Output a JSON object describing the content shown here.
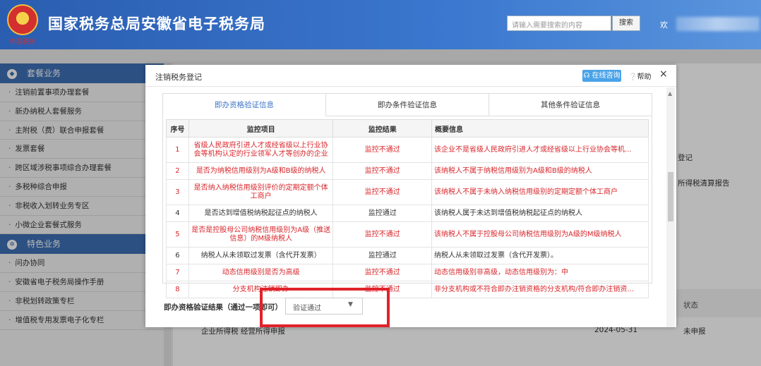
{
  "header": {
    "emblem_caption": "中国税务",
    "title": "国家税务总局安徽省电子税务局",
    "search_placeholder": "请输入需要搜索的内容",
    "search_button": "搜索",
    "welcome": "欢"
  },
  "sidebar": {
    "section1": "套餐业务",
    "section1_items": [
      "注销前置事项办理套餐",
      "新办纳税人套餐服务",
      "主附税（费）联合申报套餐",
      "发票套餐",
      "跨区域涉税事项综合办理套餐",
      "多税种综合申报",
      "非税收入划转业务专区",
      "小微企业套餐式服务"
    ],
    "section2": "特色业务",
    "section2_items": [
      "问办协同",
      "安徽省电子税务局操作手册",
      "非税划转政策专栏",
      "增值税专用发票电子化专栏"
    ]
  },
  "background": {
    "text1": "登记",
    "text2": "所得税清算报告",
    "status_head": "状态",
    "row_text": "企业所得税 经营所得申报",
    "row_date": "2024-05-31",
    "row_status": "未申报"
  },
  "modal": {
    "title": "注销税务登记",
    "online_label": "在线咨询",
    "help_label": "帮助",
    "close_glyph": "×",
    "tabs": [
      "即办资格验证信息",
      "即办条件验证信息",
      "其他条件验证信息"
    ],
    "table_headers": [
      "序号",
      "监控项目",
      "监控结果",
      "概要信息"
    ],
    "rows": [
      {
        "no": "1",
        "item": "省级人民政府引进人才或经省级以上行业协会等机构认定的行业领军人才等创办的企业",
        "result": "监控不通过",
        "desc": "该企业不是省级人民政府引进人才或经省级以上行业协会等机...",
        "fail": true
      },
      {
        "no": "2",
        "item": "是否为纳税信用级别为A级和B级的纳税人",
        "result": "监控不通过",
        "desc": "该纳税人不属于纳税信用级别为A级和B级的纳税人",
        "fail": true
      },
      {
        "no": "3",
        "item": "是否纳入纳税信用级别评价的定期定额个体工商户",
        "result": "监控不通过",
        "desc": "该纳税人不属于未纳入纳税信用级别的定期定额个体工商户",
        "fail": true
      },
      {
        "no": "4",
        "item": "是否达到增值税纳税起征点的纳税人",
        "result": "监控通过",
        "desc": "该纳税人属于未达到增值税纳税起征点的纳税人",
        "fail": false
      },
      {
        "no": "5",
        "item": "是否是控股母公司纳税信用级别为A级（推送信息）的M级纳税人",
        "result": "监控不通过",
        "desc": "该纳税人不属于控股母公司纳税信用级别为A级的M级纳税人",
        "fail": true
      },
      {
        "no": "6",
        "item": "纳税人从未领取过发票（含代开发票）",
        "result": "监控通过",
        "desc": "纳税人从未领取过发票（含代开发票）。",
        "fail": false
      },
      {
        "no": "7",
        "item": "动态信用级别是否为高级",
        "result": "监控不通过",
        "desc": "动态信用级别非高级，动态信用级别为：中",
        "fail": true
      },
      {
        "no": "8",
        "item": "分支机构注销即办",
        "result": "监控不通过",
        "desc": "非分支机构或不符合即办注销资格的分支机构/符合即办注销资...",
        "fail": true
      }
    ],
    "result_label": "即办资格验证结果（通过一项即可）",
    "result_value": "验证通过"
  },
  "colors": {
    "fail": "#d9262b",
    "accent": "#3a74c8",
    "highlight_box": "#e0222a"
  }
}
